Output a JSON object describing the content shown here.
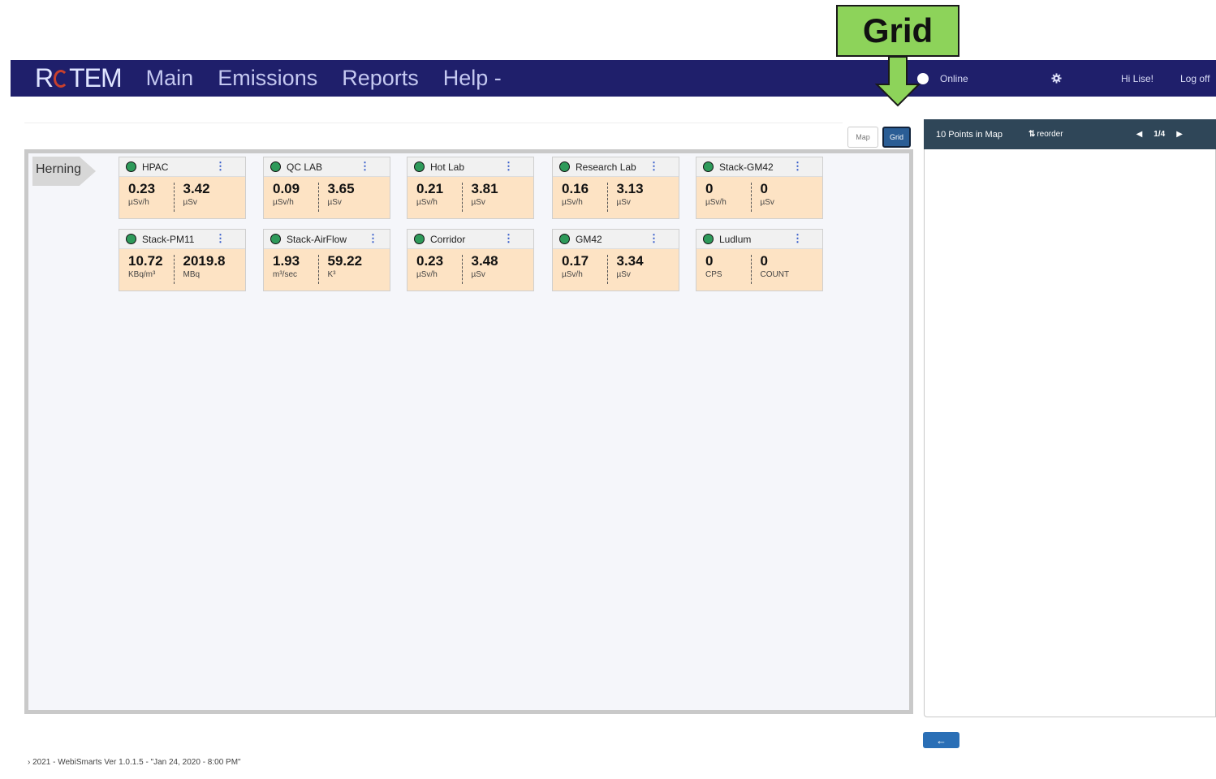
{
  "callout": {
    "label": "Grid"
  },
  "navbar": {
    "brand_left": "R",
    "brand_right": "TEM",
    "items": [
      {
        "label": "Main"
      },
      {
        "label": "Emissions"
      },
      {
        "label": "Reports"
      },
      {
        "label": "Help -"
      }
    ],
    "status": "Online",
    "greeting": "Hi Lise!",
    "logoff": "Log off"
  },
  "view_toggle": {
    "map": "Map",
    "grid": "Grid",
    "active": "Grid"
  },
  "site": {
    "name": "Herning"
  },
  "tiles": [
    {
      "name": "HPAC",
      "v1": "0.23",
      "u1": "µSv/h",
      "v2": "3.42",
      "u2": "µSv"
    },
    {
      "name": "QC LAB",
      "v1": "0.09",
      "u1": "µSv/h",
      "v2": "3.65",
      "u2": "µSv"
    },
    {
      "name": "Hot Lab",
      "v1": "0.21",
      "u1": "µSv/h",
      "v2": "3.81",
      "u2": "µSv"
    },
    {
      "name": "Research Lab",
      "v1": "0.16",
      "u1": "µSv/h",
      "v2": "3.13",
      "u2": "µSv"
    },
    {
      "name": "Stack-GM42",
      "v1": "0",
      "u1": "µSv/h",
      "v2": "0",
      "u2": "µSv"
    },
    {
      "name": "Stack-PM11",
      "v1": "10.72",
      "u1": "KBq/m³",
      "v2": "2019.8",
      "u2": "MBq"
    },
    {
      "name": "Stack-AirFlow",
      "v1": "1.93",
      "u1": "m³/sec",
      "v2": "59.22",
      "u2": "K³"
    },
    {
      "name": "Corridor",
      "v1": "0.23",
      "u1": "µSv/h",
      "v2": "3.48",
      "u2": "µSv"
    },
    {
      "name": "GM42",
      "v1": "0.17",
      "u1": "µSv/h",
      "v2": "3.34",
      "u2": "µSv"
    },
    {
      "name": "Ludlum",
      "v1": "0",
      "u1": "CPS",
      "v2": "0",
      "u2": "COUNT"
    }
  ],
  "side_panel": {
    "title": "10 Points in Map",
    "reorder": "reorder",
    "page": "1/4",
    "back": "←"
  },
  "footer": {
    "text": "› 2021 - WebiSmarts Ver 1.0.1.5 - \"Jan 24, 2020 - 8:00 PM\""
  },
  "colors": {
    "navbar": "#1f1f6b",
    "tile_body": "#fde3c4",
    "status_dot": "#2e9a5a",
    "callout": "#8dd35a",
    "accent": "#2a5d95"
  }
}
